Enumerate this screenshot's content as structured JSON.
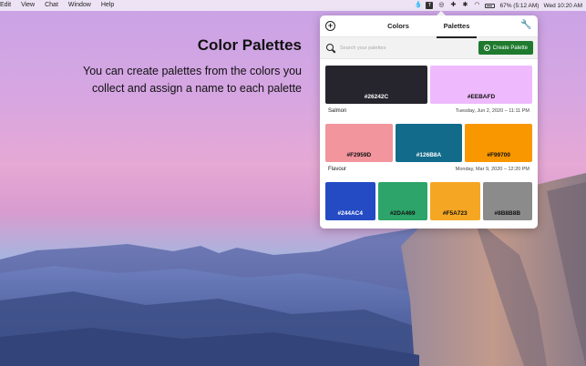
{
  "menubar": {
    "items": [
      "Edit",
      "View",
      "Chat",
      "Window",
      "Help"
    ],
    "battery": "67% (5:12 AM)",
    "clock": "Wed 10:20 AM"
  },
  "marketing": {
    "headline": "Color Palettes",
    "subline": "You can create palettes from the colors you collect and assign a name to each palette"
  },
  "panel": {
    "tabs": {
      "colors": "Colors",
      "palettes": "Palettes"
    },
    "search": {
      "placeholder": "Search your palettes",
      "value": ""
    },
    "create_button": "Create Palette",
    "palettes": [
      {
        "name": "Salmon",
        "date": "Tuesday, Jun 2, 2020 – 11:11 PM",
        "colors": [
          {
            "hex": "#26242C",
            "label": "#26242C",
            "text": "light"
          },
          {
            "hex": "#EEBAFD",
            "label": "#EEBAFD",
            "text": "dark"
          }
        ]
      },
      {
        "name": "Flavour",
        "date": "Monday, Mar 9, 2020 – 12:20 PM",
        "colors": [
          {
            "hex": "#F2959D",
            "label": "#F2959D",
            "text": "dark"
          },
          {
            "hex": "#126B8A",
            "label": "#126B8A",
            "text": "light"
          },
          {
            "hex": "#F99700",
            "label": "#F99700",
            "text": "dark"
          }
        ]
      },
      {
        "name": "",
        "date": "",
        "colors": [
          {
            "hex": "#244AC4",
            "label": "#244AC4",
            "text": "light"
          },
          {
            "hex": "#2DA469",
            "label": "#2DA469",
            "text": "dark"
          },
          {
            "hex": "#F5A723",
            "label": "#F5A723",
            "text": "dark"
          },
          {
            "hex": "#8B8B8B",
            "label": "#8B8B8B",
            "text": "dark"
          }
        ]
      }
    ]
  },
  "colors": {
    "accent": "#1F7A2E"
  }
}
